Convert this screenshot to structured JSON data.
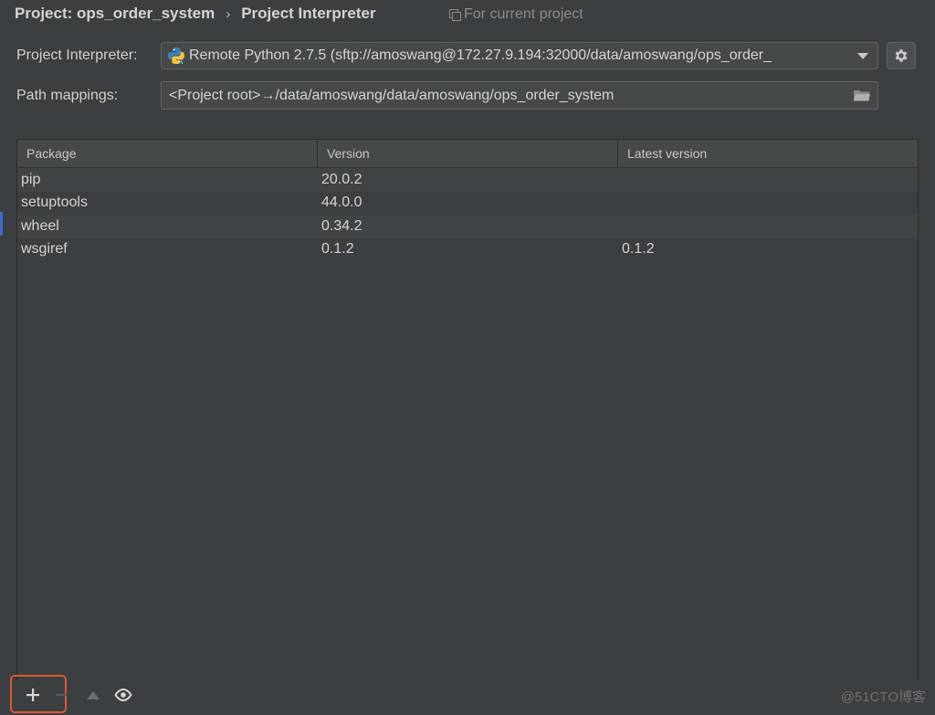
{
  "header": {
    "crumb_project": "Project: ops_order_system",
    "crumb_separator": "›",
    "crumb_page": "Project Interpreter",
    "scope_label": "For current project"
  },
  "interpreter": {
    "label": "Project Interpreter:",
    "value": "Remote Python 2.7.5 (sftp://amoswang@172.27.9.194:32000/data/amoswang/ops_order_"
  },
  "path_mappings": {
    "label": "Path mappings:",
    "value": "<Project root>→/data/amoswang/data/amoswang/ops_order_system"
  },
  "table": {
    "columns": [
      "Package",
      "Version",
      "Latest version"
    ],
    "rows": [
      {
        "package": "pip",
        "version": "20.0.2",
        "latest": ""
      },
      {
        "package": "setuptools",
        "version": "44.0.0",
        "latest": ""
      },
      {
        "package": "wheel",
        "version": "0.34.2",
        "latest": ""
      },
      {
        "package": "wsgiref",
        "version": "0.1.2",
        "latest": "0.1.2"
      }
    ]
  },
  "toolbar": {
    "add_label": "+",
    "remove_label": "−"
  },
  "watermark": "@51CTO博客",
  "colors": {
    "background": "#3c3f41",
    "field": "#45494a",
    "highlight": "#e0572f",
    "accent": "#3d6bd6"
  },
  "icons": [
    "python-interpreter-icon",
    "chevron-down-icon",
    "gear-icon",
    "folder-icon",
    "plus-icon",
    "minus-icon",
    "upgrade-icon",
    "eye-icon"
  ]
}
